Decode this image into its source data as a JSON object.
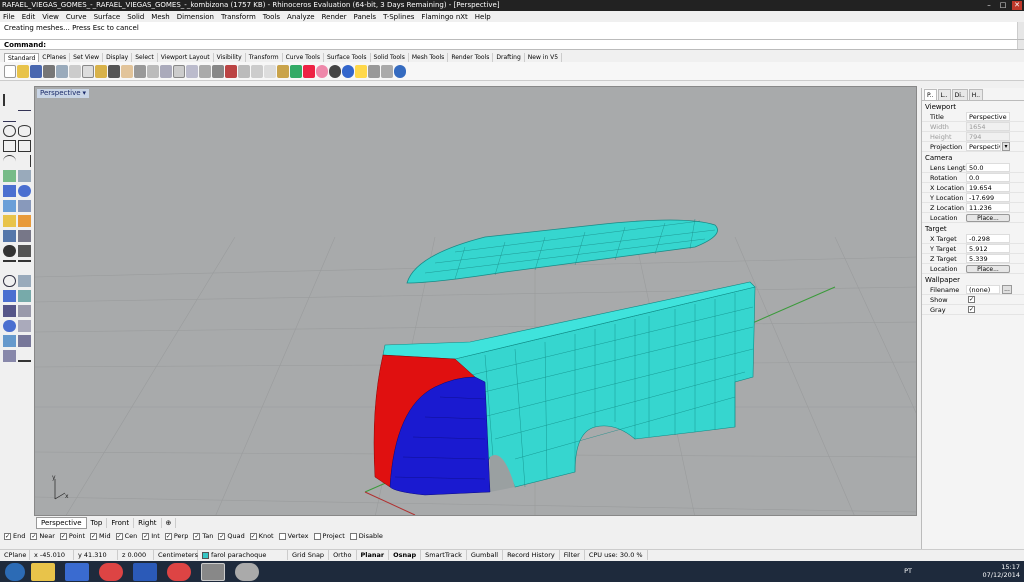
{
  "window": {
    "title": "RAFAEL_VIEGAS_GOMES_-_RAFAEL_VIEGAS_GOMES_-_kombizona (1757 KB) - Rhinoceros Evaluation (64-bit, 3 Days Remaining) - [Perspective]",
    "min": "–",
    "max": "□",
    "close": "✕"
  },
  "menu": [
    "File",
    "Edit",
    "View",
    "Curve",
    "Surface",
    "Solid",
    "Mesh",
    "Dimension",
    "Transform",
    "Tools",
    "Analyze",
    "Render",
    "Panels",
    "T-Splines",
    "Flamingo nXt",
    "Help"
  ],
  "command": {
    "history": "Creating meshes... Press Esc to cancel",
    "prompt": "Command:"
  },
  "toolbar_tabs": [
    "Standard",
    "CPlanes",
    "Set View",
    "Display",
    "Select",
    "Viewport Layout",
    "Visibility",
    "Transform",
    "Curve Tools",
    "Surface Tools",
    "Solid Tools",
    "Mesh Tools",
    "Render Tools",
    "Drafting",
    "New in V5"
  ],
  "viewport": {
    "title": "Perspective",
    "arrow": "▾",
    "axis_x": "x",
    "axis_y": "y"
  },
  "view_tabs": [
    "Perspective",
    "Top",
    "Front",
    "Right",
    "⊕"
  ],
  "panel": {
    "tabs": [
      "P..",
      "L..",
      "Di..",
      "H.."
    ],
    "viewport_section": "Viewport",
    "title_label": "Title",
    "title_value": "Perspective",
    "width_label": "Width",
    "width_value": "1654",
    "height_label": "Height",
    "height_value": "794",
    "projection_label": "Projection",
    "projection_value": "Perspective",
    "camera_section": "Camera",
    "lens_label": "Lens Length",
    "lens_value": "50.0",
    "rotation_label": "Rotation",
    "rotation_value": "0.0",
    "xloc_label": "X Location",
    "xloc_value": "19.654",
    "yloc_label": "Y Location",
    "yloc_value": "-17.699",
    "zloc_label": "Z Location",
    "zloc_value": "11.236",
    "location_label": "Location",
    "place_btn": "Place...",
    "target_section": "Target",
    "xt_label": "X Target",
    "xt_value": "-0.298",
    "yt_label": "Y Target",
    "yt_value": "5.912",
    "zt_label": "Z Target",
    "zt_value": "5.339",
    "tlocation_label": "Location",
    "tplace_btn": "Place...",
    "wallpaper_section": "Wallpaper",
    "filename_label": "Filename",
    "filename_value": "(none)",
    "browse": "...",
    "show_label": "Show",
    "gray_label": "Gray"
  },
  "osnaps": [
    {
      "label": "End",
      "checked": true
    },
    {
      "label": "Near",
      "checked": true
    },
    {
      "label": "Point",
      "checked": true
    },
    {
      "label": "Mid",
      "checked": true
    },
    {
      "label": "Cen",
      "checked": true
    },
    {
      "label": "Int",
      "checked": true
    },
    {
      "label": "Perp",
      "checked": true
    },
    {
      "label": "Tan",
      "checked": true
    },
    {
      "label": "Quad",
      "checked": true
    },
    {
      "label": "Knot",
      "checked": true
    },
    {
      "label": "Vertex",
      "checked": false
    },
    {
      "label": "Project",
      "checked": false
    },
    {
      "label": "Disable",
      "checked": false
    }
  ],
  "status": {
    "cplane": "CPlane",
    "x": "x -45.010",
    "y": "y 41.310",
    "z": "z 0.000",
    "units": "Centimeters",
    "layer": "farol parachoque",
    "grid_snap": "Grid Snap",
    "ortho": "Ortho",
    "planar": "Planar",
    "osnap": "Osnap",
    "smarttrack": "SmartTrack",
    "gumball": "Gumball",
    "record_history": "Record History",
    "filter": "Filter",
    "cpu": "CPU use: 30.0 %"
  },
  "taskbar": {
    "lang": "PT",
    "time": "15:17",
    "date": "07/12/2014"
  },
  "colors": {
    "model_cyan": "#36d6cf",
    "model_red": "#e01010",
    "model_blue": "#1a1ad0",
    "viewport_bg": "#a8aaab"
  }
}
